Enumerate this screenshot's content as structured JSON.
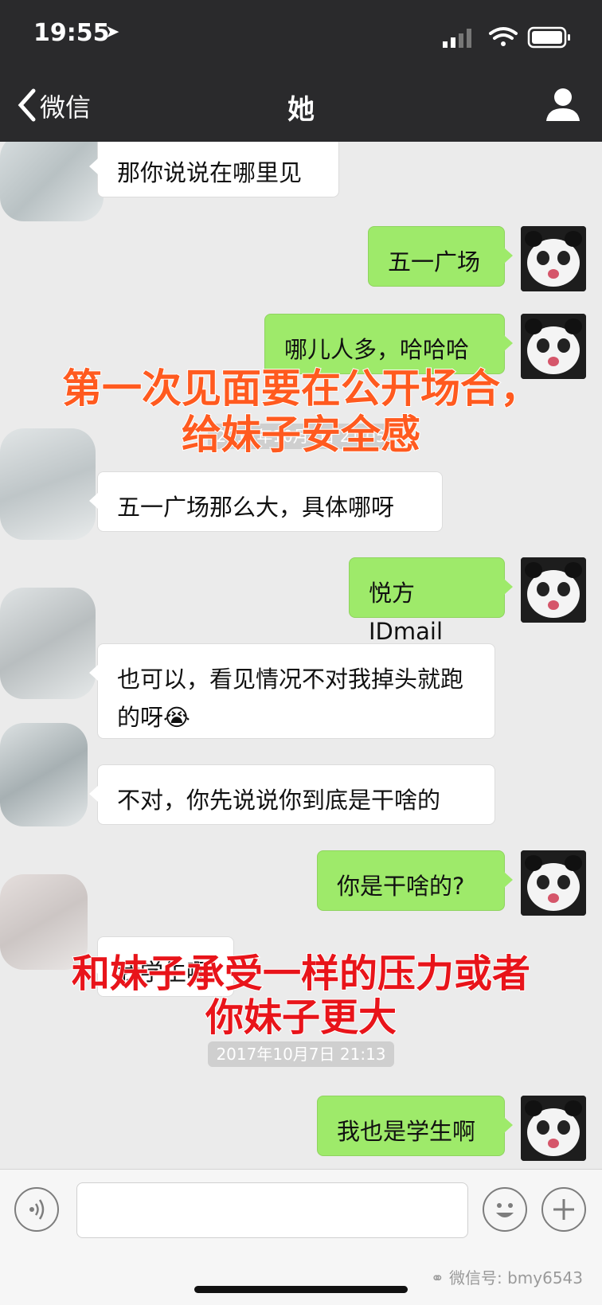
{
  "status_bar": {
    "time": "19:55",
    "location_icon": "location-arrow-icon",
    "signal_icon": "cellular-signal-icon",
    "wifi_icon": "wifi-icon",
    "battery_icon": "battery-icon"
  },
  "nav": {
    "back_label": "微信",
    "back_icon": "chevron-left-icon",
    "title": "她",
    "profile_icon": "person-icon"
  },
  "messages": [
    {
      "side": "in",
      "text": "那你说说在哪里见"
    },
    {
      "side": "out",
      "text": "五一广场"
    },
    {
      "side": "out",
      "text": "哪儿人多，哈哈哈"
    },
    {
      "side": "in",
      "text": "五一广场那么大，具体哪呀"
    },
    {
      "side": "out",
      "text": "悦方IDmail"
    },
    {
      "side": "in",
      "text": "也可以，看见情况不对我掉头就跑的呀",
      "emoji": "😭"
    },
    {
      "side": "in",
      "text": "不对，你先说说你到底是干啥的"
    },
    {
      "side": "out",
      "text": "你是干啥的?"
    },
    {
      "side": "in",
      "text": "我学生啊"
    },
    {
      "side": "out",
      "text": "我也是学生啊"
    }
  ],
  "timestamps": [
    "2017年10月7日 21:05",
    "2017年10月7日 21:13"
  ],
  "captions": {
    "first": [
      "第一次见面要在公开场合，",
      "给妹子安全感"
    ],
    "second": [
      "和妹子承受一样的压力或者",
      "你妹子更大"
    ]
  },
  "input_bar": {
    "voice_icon": "voice-icon",
    "emoji_icon": "emoji-icon",
    "add_icon": "plus-icon",
    "watermark": "微信号: bmy6543"
  },
  "colors": {
    "header_bg": "#2a2a2c",
    "chat_bg": "#ebebeb",
    "outgoing_bubble": "#9eea6a",
    "incoming_bubble": "#ffffff",
    "caption_orange": "#ff5a1f",
    "caption_red": "#e8141a"
  }
}
